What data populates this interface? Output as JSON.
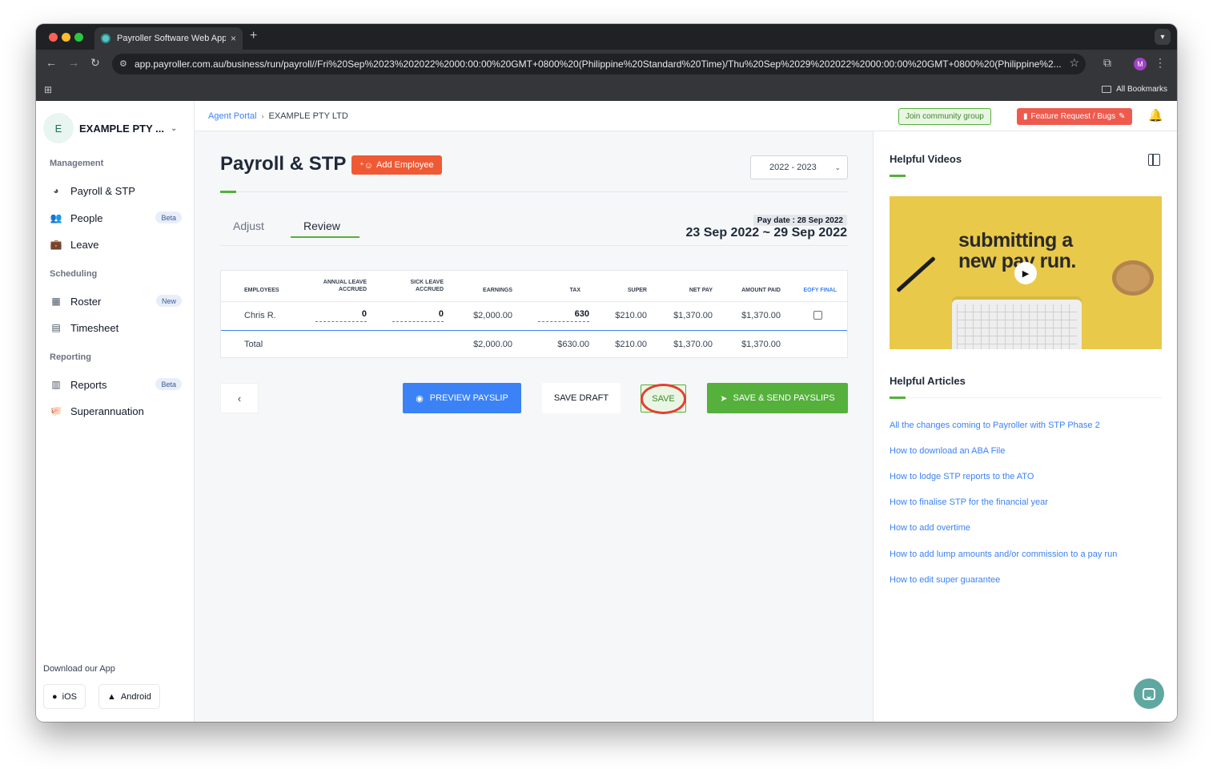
{
  "browser": {
    "tab_title": "Payroller Software Web Appli",
    "tab_close": "×",
    "new_tab": "+",
    "url": "app.payroller.com.au/business/run/payroll//Fri%20Sep%2023%202022%2000:00:00%20GMT+0800%20(Philippine%20Standard%20Time)/Thu%20Sep%2029%202022%2000:00:00%20GMT+0800%20(Philippine%2...",
    "profile_initial": "M",
    "all_bookmarks": "All Bookmarks"
  },
  "sidebar": {
    "org_initial": "E",
    "org_name": "EXAMPLE PTY ...",
    "sections": {
      "management": "Management",
      "scheduling": "Scheduling",
      "reporting": "Reporting"
    },
    "items": [
      {
        "label": "Payroll & STP",
        "icon": "payroll-icon"
      },
      {
        "label": "People",
        "icon": "people-icon",
        "badge": "Beta"
      },
      {
        "label": "Leave",
        "icon": "leave-icon"
      },
      {
        "label": "Roster",
        "icon": "roster-icon",
        "badge": "New"
      },
      {
        "label": "Timesheet",
        "icon": "timesheet-icon"
      },
      {
        "label": "Reports",
        "icon": "reports-icon",
        "badge": "Beta"
      },
      {
        "label": "Superannuation",
        "icon": "superannuation-icon"
      }
    ],
    "download_label": "Download our App",
    "ios_label": "iOS",
    "android_label": "Android"
  },
  "topbar": {
    "breadcrumb_root": "Agent Portal",
    "breadcrumb_current": "EXAMPLE PTY LTD",
    "community_button": "Join community group",
    "feature_button": "Feature Request / Bugs"
  },
  "main": {
    "title": "Payroll & STP",
    "add_employee": "Add Employee",
    "year_select": "2022 - 2023",
    "tabs": [
      {
        "label": "Adjust"
      },
      {
        "label": "Review"
      }
    ],
    "active_tab": "Review",
    "pay_date": "Pay date : 28 Sep 2022",
    "period": "23 Sep 2022 ~ 29 Sep 2022",
    "table": {
      "headers": {
        "employees": "EMPLOYEES",
        "annual_leave_1": "ANNUAL LEAVE",
        "annual_leave_2": "ACCRUED",
        "sick_leave_1": "SICK LEAVE",
        "sick_leave_2": "ACCRUED",
        "earnings": "EARNINGS",
        "tax": "TAX",
        "super": "SUPER",
        "net_pay": "NET PAY",
        "amount_paid": "AMOUNT PAID",
        "eofy_final": "EOFY FINAL"
      },
      "row": {
        "employee": "Chris R.",
        "annual_leave": "0",
        "sick_leave": "0",
        "earnings": "$2,000.00",
        "tax": "630",
        "super": "$210.00",
        "net_pay": "$1,370.00",
        "amount_paid": "$1,370.00",
        "eofy_final": false
      },
      "total": {
        "label": "Total",
        "earnings": "$2,000.00",
        "tax": "$630.00",
        "super": "$210.00",
        "net_pay": "$1,370.00",
        "amount_paid": "$1,370.00"
      }
    },
    "buttons": {
      "back": "‹",
      "preview": "PREVIEW PAYSLIP",
      "save_draft": "SAVE DRAFT",
      "save": "SAVE",
      "save_send": "SAVE & SEND PAYSLIPS"
    }
  },
  "right": {
    "videos_title": "Helpful Videos",
    "video_text_line1": "submitting a",
    "video_text_line2": "new pay run.",
    "articles_title": "Helpful Articles",
    "articles": [
      "All the changes coming to Payroller with STP Phase 2",
      "How to download an ABA File",
      "How to lodge STP reports to the ATO",
      "How to finalise STP for the financial year",
      "How to add overtime",
      "How to add lump amounts and/or commission to a pay run",
      "How to edit super guarantee"
    ]
  },
  "colors": {
    "brand_green": "#55b03c",
    "accent_orange": "#ef5a35",
    "link_blue": "#3b82f6",
    "highlight_red": "#e53e2f"
  }
}
